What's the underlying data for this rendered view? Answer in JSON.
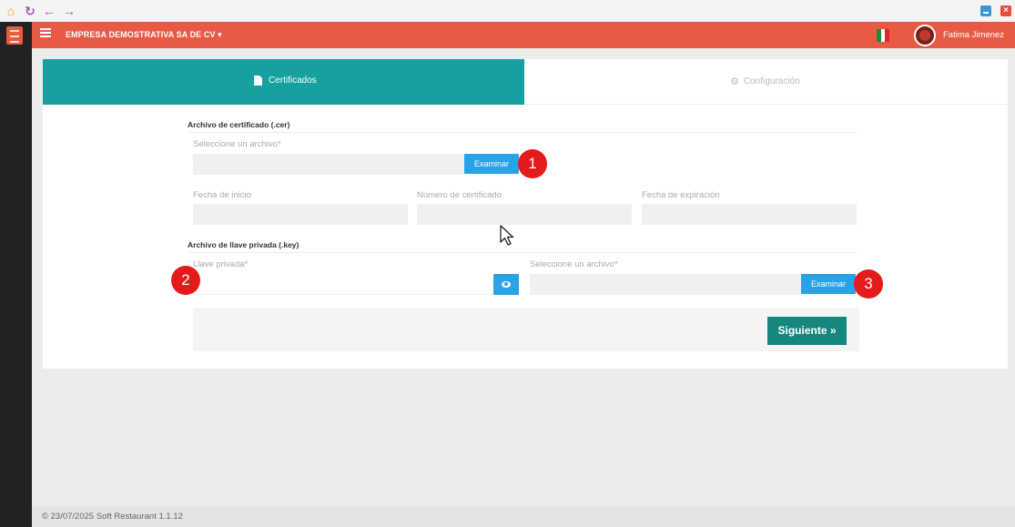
{
  "chrome": {
    "icons": [
      "home-icon",
      "refresh-icon",
      "back-arrow-icon",
      "forward-arrow-icon"
    ],
    "window_controls": [
      "minimize",
      "close"
    ]
  },
  "header": {
    "company": "EMPRESA DEMOSTRATIVA SA DE CV ▾",
    "user_name": "Fatima Jimenez",
    "accent_color": "#e95a45"
  },
  "tabs": [
    {
      "label": "Certificados",
      "icon": "document-icon",
      "active": true
    },
    {
      "label": "Configuración",
      "icon": "gears-icon",
      "active": false
    }
  ],
  "certificate": {
    "section_title": "Archivo de certificado (.cer)",
    "file_label": "Seleccione un archivo*",
    "file_value": "",
    "browse_label": "Examinar",
    "start_date_label": "Fecha de inicio",
    "start_date_value": "",
    "cert_number_label": "Número de certificado",
    "cert_number_value": "",
    "expiration_label": "Fecha de expiración",
    "expiration_value": ""
  },
  "private_key": {
    "section_title": "Archivo de llave privada (.key)",
    "password_label": "Llave privada*",
    "password_value": "",
    "file_label": "Seleccione un archivo*",
    "file_value": "",
    "browse_label": "Examinar"
  },
  "annotations": [
    "1",
    "2",
    "3"
  ],
  "next_label": "Siguiente »",
  "footer": {
    "status": "© 23/07/2025 Soft Restaurant 1.1.12"
  },
  "colors": {
    "teal": "#16a0a0",
    "blue_button": "#2aa2e6",
    "next_button": "#15877e",
    "badge_red": "#e31b1b"
  }
}
